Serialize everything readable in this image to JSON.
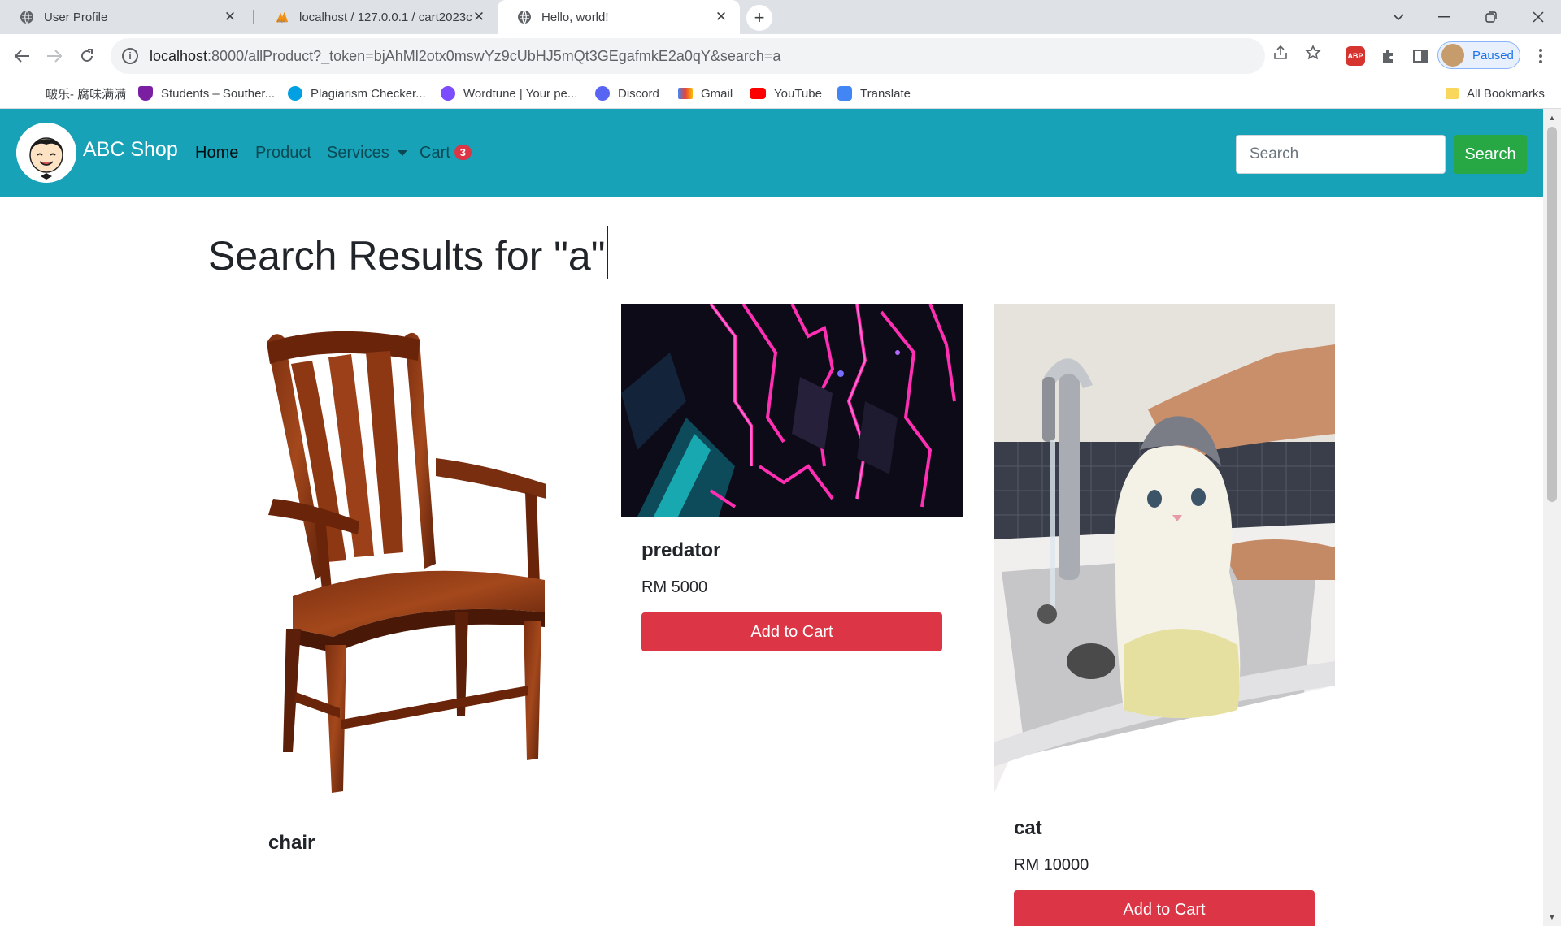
{
  "browser": {
    "tabs": [
      {
        "title": "User Profile",
        "icon": "globe-icon",
        "active": false
      },
      {
        "title": "localhost / 127.0.0.1 / cart2023c",
        "icon": "phpmyadmin-icon",
        "active": false
      },
      {
        "title": "Hello, world!",
        "icon": "globe-icon",
        "active": true
      }
    ],
    "new_tab_label": "+",
    "address": {
      "host": "localhost",
      "rest": ":8000/allProduct?_token=bjAhMl2otx0mswYz9cUbHJ5mQt3GEgafmkE2a0qY&search=a"
    },
    "profile_label": "Paused",
    "abp_label": "ABP",
    "bookmarks": [
      {
        "label": "啵乐- 腐味满满",
        "icon_color": "#ffffff"
      },
      {
        "label": "Students – Souther...",
        "icon_color": "#7b1fa2"
      },
      {
        "label": "Plagiarism Checker...",
        "icon_color": "#00a0e3"
      },
      {
        "label": "Wordtune | Your pe...",
        "icon_color": "#7c4dff"
      },
      {
        "label": "Discord",
        "icon_color": "#5865f2"
      },
      {
        "label": "Gmail",
        "icon_color": "#ea4335"
      },
      {
        "label": "YouTube",
        "icon_color": "#ff0000"
      },
      {
        "label": "Translate",
        "icon_color": "#4285f4"
      }
    ],
    "all_bookmarks_label": "All Bookmarks"
  },
  "site": {
    "brand": "ABC Shop",
    "nav": {
      "home": "Home",
      "product": "Product",
      "services": "Services",
      "cart": "Cart",
      "cart_count": "3"
    },
    "search": {
      "placeholder": "Search",
      "button": "Search"
    },
    "accent_color": "#17a2b8"
  },
  "page": {
    "title": "Search Results for \"a\""
  },
  "products": [
    {
      "name": "chair",
      "price": "",
      "image": "chair"
    },
    {
      "name": "predator",
      "price": "RM 5000",
      "image": "neon-abstract",
      "button": "Add to Cart"
    },
    {
      "name": "cat",
      "price": "RM 10000",
      "image": "cat-bath",
      "button": "Add to Cart"
    }
  ]
}
